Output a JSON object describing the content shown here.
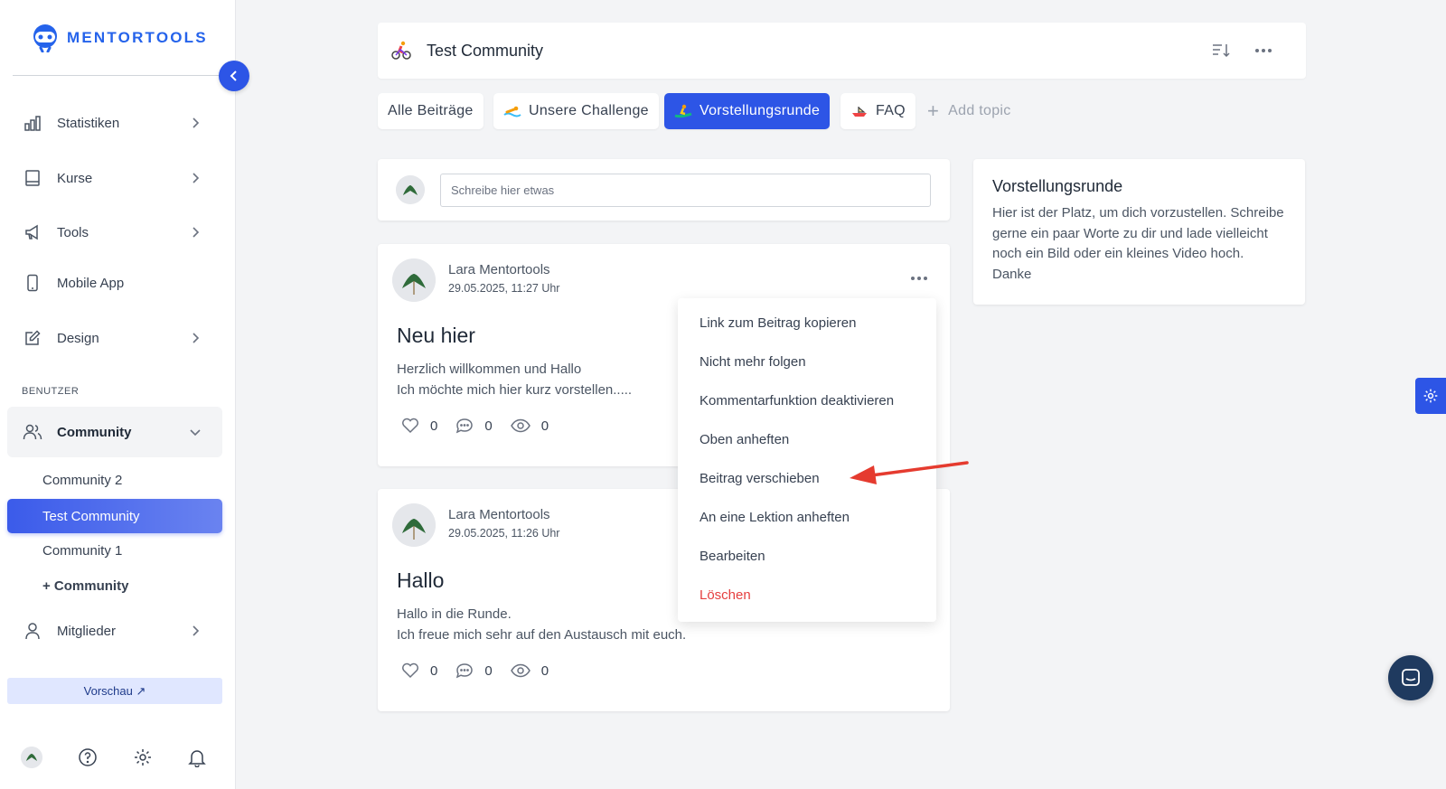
{
  "sidebar": {
    "logo": "MENTORTOOLS",
    "nav": [
      {
        "label": "Statistiken",
        "icon": "bar-chart-icon"
      },
      {
        "label": "Kurse",
        "icon": "book-icon"
      },
      {
        "label": "Tools",
        "icon": "megaphone-icon"
      },
      {
        "label": "Mobile App",
        "icon": "phone-icon"
      },
      {
        "label": "Design",
        "icon": "pencil-icon"
      }
    ],
    "section_label": "BENUTZER",
    "community_label": "Community",
    "sub_items": [
      "Community 2",
      "Test Community",
      "Community 1",
      "+ Community"
    ],
    "members_label": "Mitglieder",
    "preview_label": "Vorschau ↗"
  },
  "header": {
    "title": "Test Community"
  },
  "topics": [
    {
      "label": "Alle Beiträge"
    },
    {
      "label": "Unsere Challenge"
    },
    {
      "label": "Vorstellungsrunde",
      "active": true
    },
    {
      "label": "FAQ"
    }
  ],
  "add_topic_label": "Add topic",
  "composer": {
    "placeholder": "Schreibe hier etwas"
  },
  "posts": [
    {
      "author": "Lara Mentortools",
      "date": "29.05.2025, 11:27 Uhr",
      "title": "Neu hier",
      "body_line1": "Herzlich willkommen und Hallo",
      "body_line2": "Ich möchte mich hier kurz vorstellen.....",
      "likes": "0",
      "comments": "0",
      "views": "0"
    },
    {
      "author": "Lara Mentortools",
      "date": "29.05.2025, 11:26 Uhr",
      "title": "Hallo",
      "body_line1": "Hallo in die Runde.",
      "body_line2": "Ich freue mich sehr auf den Austausch mit euch.",
      "likes": "0",
      "comments": "0",
      "views": "0"
    }
  ],
  "info": {
    "title": "Vorstellungsrunde",
    "text": "Hier ist der Platz, um dich vorzustellen. Schreibe gerne ein paar Worte zu dir und lade vielleicht noch ein Bild oder ein kleines Video hoch. Danke"
  },
  "menu": [
    "Link zum Beitrag kopieren",
    "Nicht mehr folgen",
    "Kommentarfunktion deaktivieren",
    "Oben anheften",
    "Beitrag verschieben",
    "An eine Lektion anheften",
    "Bearbeiten",
    "Löschen"
  ],
  "colors": {
    "accent": "#2d55e6",
    "danger": "#e53e3e",
    "annotation_arrow": "#e53b2f"
  }
}
